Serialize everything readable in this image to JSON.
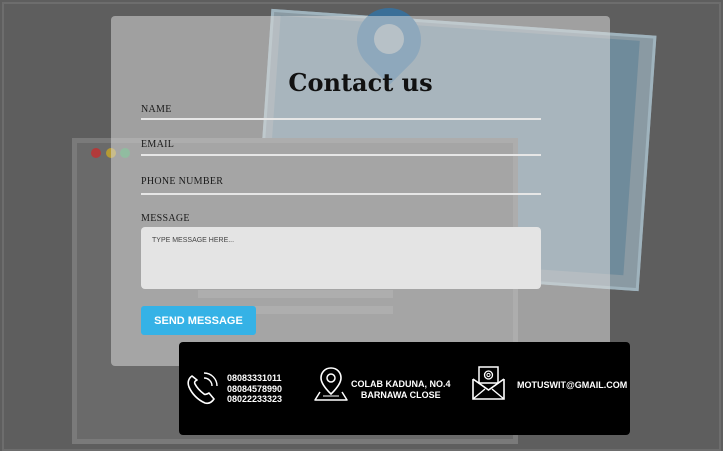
{
  "form": {
    "title": "Contact us",
    "fields": [
      {
        "label": "NAME"
      },
      {
        "label": "EMAIL"
      },
      {
        "label": "PHONE NUMBER"
      }
    ],
    "message": {
      "label": "MESSAGE",
      "placeholder": "TYPE MESSAGE HERE..."
    },
    "submit_label": "SEND MESSAGE"
  },
  "contact": {
    "phones": [
      "08083331011",
      "08084578990",
      "08022233323"
    ],
    "address": [
      "COLAB KADUNA, NO.4",
      "BARNAWA CLOSE"
    ],
    "email": "MOTUSWIT@GMAIL.COM"
  },
  "icons": {
    "phone": "phone-icon",
    "location": "map-pin-icon",
    "email": "envelope-icon"
  },
  "colors": {
    "accent": "#35b2e6",
    "contact_bar": "#000000",
    "backdrop": "#5e5e5e"
  }
}
